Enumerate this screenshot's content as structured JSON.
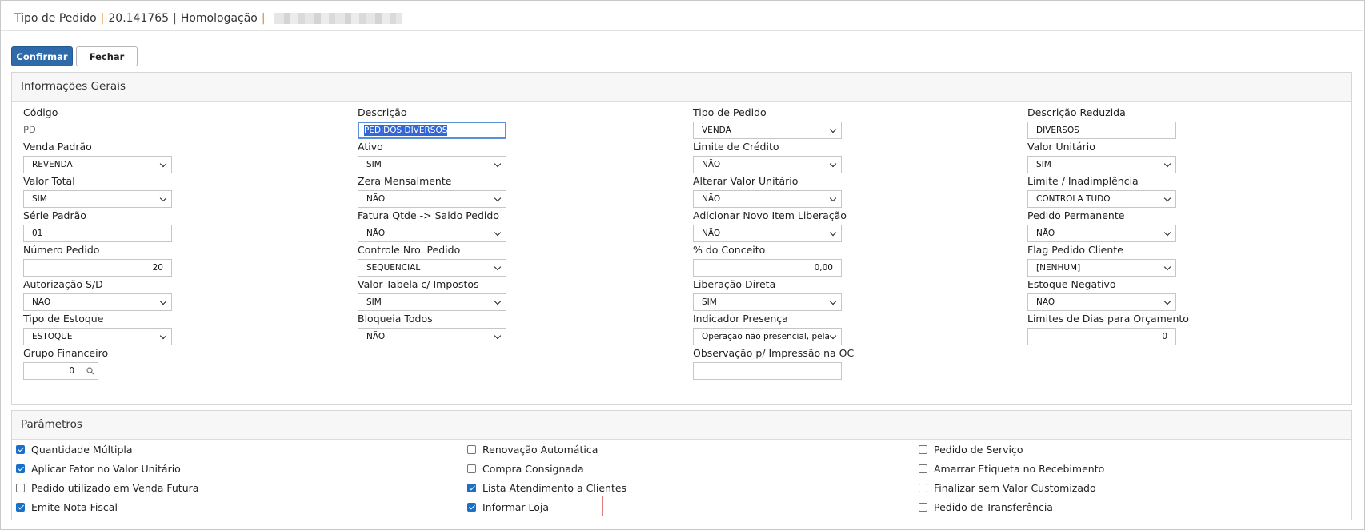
{
  "header": {
    "title": "Tipo de Pedido",
    "code": "20.141765",
    "environment": "Homologação"
  },
  "toolbar": {
    "confirm_label": "Confirmar",
    "close_label": "Fechar"
  },
  "general": {
    "title": "Informações Gerais",
    "codigo": {
      "label": "Código",
      "value": "PD"
    },
    "descricao": {
      "label": "Descrição",
      "value": "PEDIDOS DIVERSOS"
    },
    "tipo_pedido": {
      "label": "Tipo de Pedido",
      "value": "VENDA"
    },
    "descricao_reduzida": {
      "label": "Descrição Reduzida",
      "value": "DIVERSOS"
    },
    "venda_padrao": {
      "label": "Venda Padrão",
      "value": "REVENDA"
    },
    "ativo": {
      "label": "Ativo",
      "value": "SIM"
    },
    "limite_credito": {
      "label": "Limite de Crédito",
      "value": "NÃO"
    },
    "valor_unitario": {
      "label": "Valor Unitário",
      "value": "SIM"
    },
    "valor_total": {
      "label": "Valor Total",
      "value": "SIM"
    },
    "zera_mensalmente": {
      "label": "Zera Mensalmente",
      "value": "NÃO"
    },
    "alterar_valor_unitario": {
      "label": "Alterar Valor Unitário",
      "value": "NÃO"
    },
    "limite_inadimplencia": {
      "label": "Limite / Inadimplência",
      "value": "CONTROLA TUDO"
    },
    "serie_padrao": {
      "label": "Série Padrão",
      "value": "01"
    },
    "fatura_qtde": {
      "label": "Fatura Qtde -> Saldo Pedido",
      "value": "NÃO"
    },
    "adicionar_novo_item": {
      "label": "Adicionar Novo Item Liberação",
      "value": "NÃO"
    },
    "pedido_permanente": {
      "label": "Pedido Permanente",
      "value": "NÃO"
    },
    "numero_pedido": {
      "label": "Número Pedido",
      "value": "20"
    },
    "controle_nro_pedido": {
      "label": "Controle Nro. Pedido",
      "value": "SEQUENCIAL"
    },
    "pct_conceito": {
      "label": "% do Conceito",
      "value": "0,00"
    },
    "flag_pedido_cliente": {
      "label": "Flag Pedido Cliente",
      "value": "[NENHUM]"
    },
    "autorizacao_sd": {
      "label": "Autorização S/D",
      "value": "NÃO"
    },
    "valor_tabela_impostos": {
      "label": "Valor Tabela c/ Impostos",
      "value": "SIM"
    },
    "liberacao_direta": {
      "label": "Liberação Direta",
      "value": "SIM"
    },
    "estoque_negativo": {
      "label": "Estoque Negativo",
      "value": "NÃO"
    },
    "tipo_estoque": {
      "label": "Tipo de Estoque",
      "value": "ESTOQUE"
    },
    "bloqueia_todos": {
      "label": "Bloqueia Todos",
      "value": "NÃO"
    },
    "indicador_presenca": {
      "label": "Indicador Presença",
      "value": "Operação não presencial, pela Internet"
    },
    "limites_dias_orcamento": {
      "label": "Limites de Dias para Orçamento",
      "value": "0"
    },
    "grupo_financeiro": {
      "label": "Grupo Financeiro",
      "value": "0"
    },
    "observacao_oc": {
      "label": "Observação p/ Impressão na OC",
      "value": ""
    }
  },
  "params": {
    "title": "Parâmetros",
    "items": [
      {
        "label": "Quantidade Múltipla",
        "checked": true
      },
      {
        "label": "Aplicar Fator no Valor Unitário",
        "checked": true
      },
      {
        "label": "Pedido utilizado em Venda Futura",
        "checked": false
      },
      {
        "label": "Emite Nota Fiscal",
        "checked": true
      },
      {
        "label": "Renovação Automática",
        "checked": false
      },
      {
        "label": "Compra Consignada",
        "checked": false
      },
      {
        "label": "Lista Atendimento a Clientes",
        "checked": true
      },
      {
        "label": "Informar Loja",
        "checked": true
      },
      {
        "label": "Pedido de Serviço",
        "checked": false
      },
      {
        "label": "Amarrar Etiqueta no Recebimento",
        "checked": false
      },
      {
        "label": "Finalizar sem Valor Customizado",
        "checked": false
      },
      {
        "label": "Pedido de Transferência",
        "checked": false
      }
    ]
  },
  "colors": {
    "primary": "#2e6aa9",
    "check": "#1a6fc9",
    "highlight": "#e07a7a",
    "separator": "#e08a2c"
  }
}
